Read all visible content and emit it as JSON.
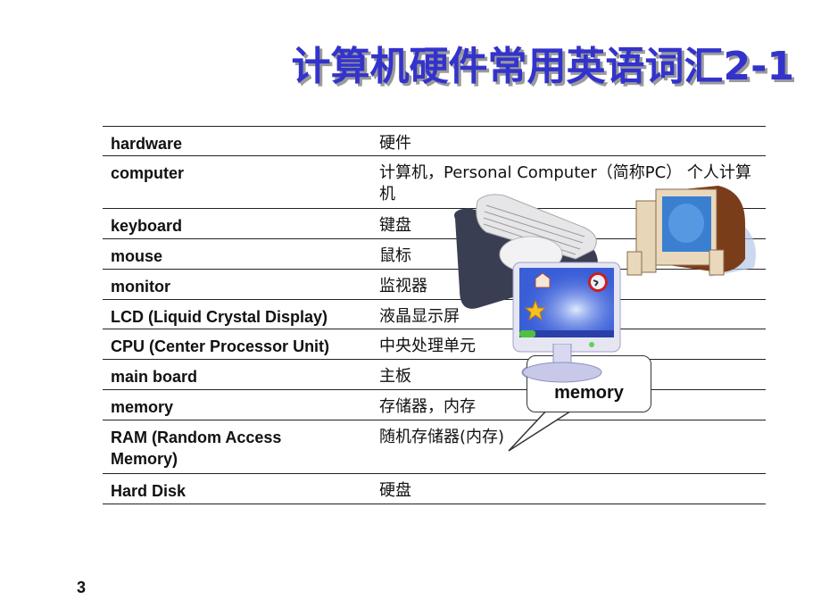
{
  "slide": {
    "title": "计算机硬件常用英语词汇2-1",
    "page_number": "3"
  },
  "vocabulary": [
    {
      "english": "hardware",
      "chinese": "硬件"
    },
    {
      "english": "computer",
      "chinese": "计算机，Personal Computer（简称PC） 个人计算机"
    },
    {
      "english": "keyboard",
      "chinese": "键盘"
    },
    {
      "english": "mouse",
      "chinese": "鼠标"
    },
    {
      "english": "monitor",
      "chinese": "监视器"
    },
    {
      "english": "LCD (Liquid Crystal Display)",
      "chinese": "液晶显示屏"
    },
    {
      "english": "CPU (Center Processor Unit)",
      "chinese": "中央处理单元"
    },
    {
      "english": "main board",
      "chinese": "主板"
    },
    {
      "english": "memory",
      "chinese": "存储器，内存"
    },
    {
      "english": "RAM (Random Access Memory)",
      "chinese": "随机存储器(内存)"
    },
    {
      "english": "Hard Disk",
      "chinese": "硬盘"
    }
  ],
  "callout": {
    "text": "memory"
  },
  "colors": {
    "title": "#3333cc",
    "title_shadow": "#9a9a9a",
    "text": "#111111",
    "rule": "#222222"
  }
}
